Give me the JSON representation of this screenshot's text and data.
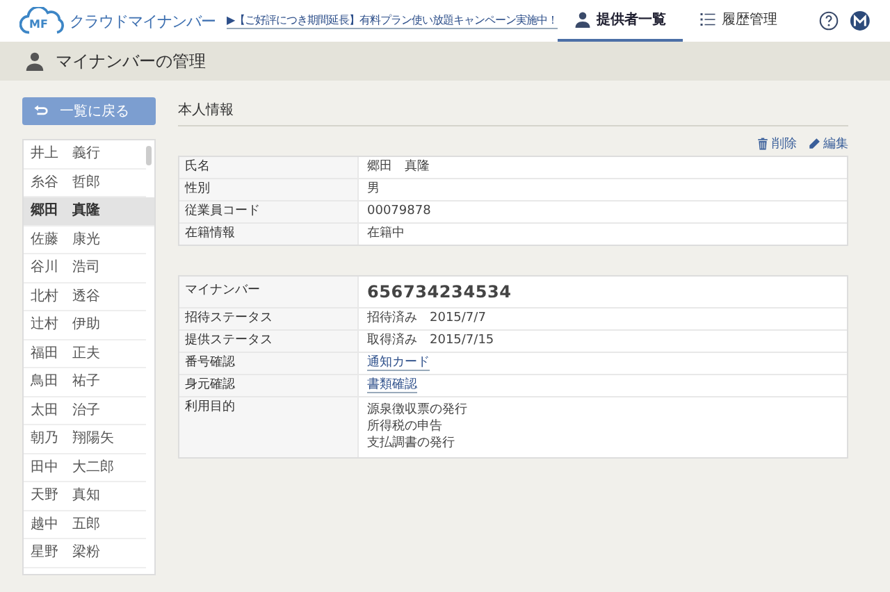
{
  "header": {
    "logo_mark": "MF",
    "logo_text": "クラウドマイナンバー",
    "announcement": "▶【ご好評につき期間延長】有料プラン使い放題キャンペーン実施中！",
    "nav": [
      {
        "label": "提供者一覧",
        "kind": "person",
        "selected": true
      },
      {
        "label": "履歴管理",
        "kind": "list",
        "selected": false
      }
    ]
  },
  "page_title": "マイナンバーの管理",
  "sidebar": {
    "back_button": "一覧に戻る",
    "items": [
      {
        "name": "井上　義行",
        "selected": false
      },
      {
        "name": "糸谷　哲郎",
        "selected": false
      },
      {
        "name": "郷田　真隆",
        "selected": true
      },
      {
        "name": "佐藤　康光",
        "selected": false
      },
      {
        "name": "谷川　浩司",
        "selected": false
      },
      {
        "name": "北村　透谷",
        "selected": false
      },
      {
        "name": "辻村　伊助",
        "selected": false
      },
      {
        "name": "福田　正夫",
        "selected": false
      },
      {
        "name": "鳥田　祐子",
        "selected": false
      },
      {
        "name": "太田　治子",
        "selected": false
      },
      {
        "name": "朝乃　翔陽矢",
        "selected": false
      },
      {
        "name": "田中　大二郎",
        "selected": false
      },
      {
        "name": "天野　真知",
        "selected": false
      },
      {
        "name": "越中　五郎",
        "selected": false
      },
      {
        "name": "星野　梁粉",
        "selected": false
      }
    ]
  },
  "section_title": "本人情報",
  "actions": [
    {
      "label": "削除",
      "kind": "trash"
    },
    {
      "label": "編集",
      "kind": "pencil"
    }
  ],
  "personal_table": [
    {
      "label": "氏名",
      "kind": "text",
      "value": "郷田　真隆"
    },
    {
      "label": "性別",
      "kind": "text",
      "value": "男"
    },
    {
      "label": "従業員コード",
      "kind": "text",
      "value": "00079878"
    },
    {
      "label": "在籍情報",
      "kind": "text",
      "value": "在籍中"
    }
  ],
  "number_table": [
    {
      "label": "マイナンバー",
      "kind": "number",
      "value": "656734234534"
    },
    {
      "label": "招待ステータス",
      "kind": "text",
      "value": "招待済み　2015/7/7"
    },
    {
      "label": "提供ステータス",
      "kind": "text",
      "value": "取得済み　2015/7/15"
    },
    {
      "label": "番号確認",
      "kind": "link",
      "value": "通知カード"
    },
    {
      "label": "身元確認",
      "kind": "link",
      "value": "書類確認"
    },
    {
      "label": "利用目的",
      "kind": "lines",
      "lines": [
        "源泉徴収票の発行",
        "所得税の申告",
        "支払調書の発行"
      ]
    }
  ]
}
